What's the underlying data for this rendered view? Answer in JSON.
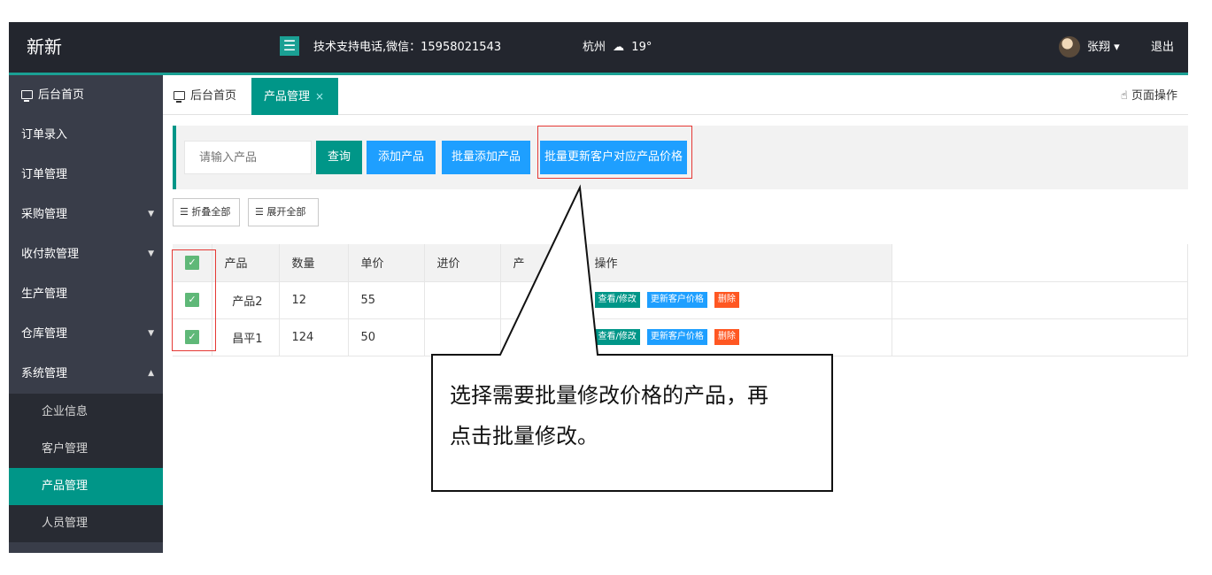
{
  "header": {
    "brand": "新新",
    "menu_icon": "☰",
    "support": "技术支持电话,微信：15958021543",
    "city": "杭州",
    "weather_icon": "☁",
    "temperature": "19°",
    "user": "张翔",
    "user_caret": "▾",
    "logout": "退出"
  },
  "sidebar": {
    "home": "后台首页",
    "items": [
      {
        "label": "订单录入",
        "caret": ""
      },
      {
        "label": "订单管理",
        "caret": ""
      },
      {
        "label": "采购管理",
        "caret": "▼"
      },
      {
        "label": "收付款管理",
        "caret": "▼"
      },
      {
        "label": "生产管理",
        "caret": ""
      },
      {
        "label": "仓库管理",
        "caret": "▼"
      },
      {
        "label": "系统管理",
        "caret": "▲"
      }
    ],
    "sub_items": [
      "企业信息",
      "客户管理",
      "产品管理",
      "人员管理"
    ]
  },
  "tabs": {
    "home": "后台首页",
    "active": "产品管理",
    "close": "×",
    "page_ops": "页面操作",
    "page_ops_icon": "☝"
  },
  "toolbar": {
    "search_placeholder": "请输入产品",
    "search": "查询",
    "add": "添加产品",
    "batch_add": "批量添加产品",
    "batch_update": "批量更新客户对应产品价格",
    "collapse_all": "折叠全部",
    "expand_all": "展开全部",
    "collapse_icon": "☰",
    "expand_icon": "☰"
  },
  "table": {
    "columns": [
      "产品",
      "数量",
      "单价",
      "进价",
      "产",
      "操作"
    ],
    "check_mark": "✓",
    "rows": [
      {
        "name": "产品2",
        "qty": "12",
        "price": "55"
      },
      {
        "name": "昌平1",
        "qty": "124",
        "price": "50"
      }
    ],
    "ops": {
      "view": "查看/修改",
      "update": "更新客户价格",
      "delete": "删除"
    }
  },
  "callout": {
    "line1": "选择需要批量修改价格的产品，再",
    "line2": "点击批量修改。"
  },
  "colors": {
    "accent": "#009688",
    "blue": "#1e9fff",
    "danger": "#ff5722",
    "highlight": "#e53935",
    "sidebar": "#393d49",
    "topbar": "#23262e"
  }
}
